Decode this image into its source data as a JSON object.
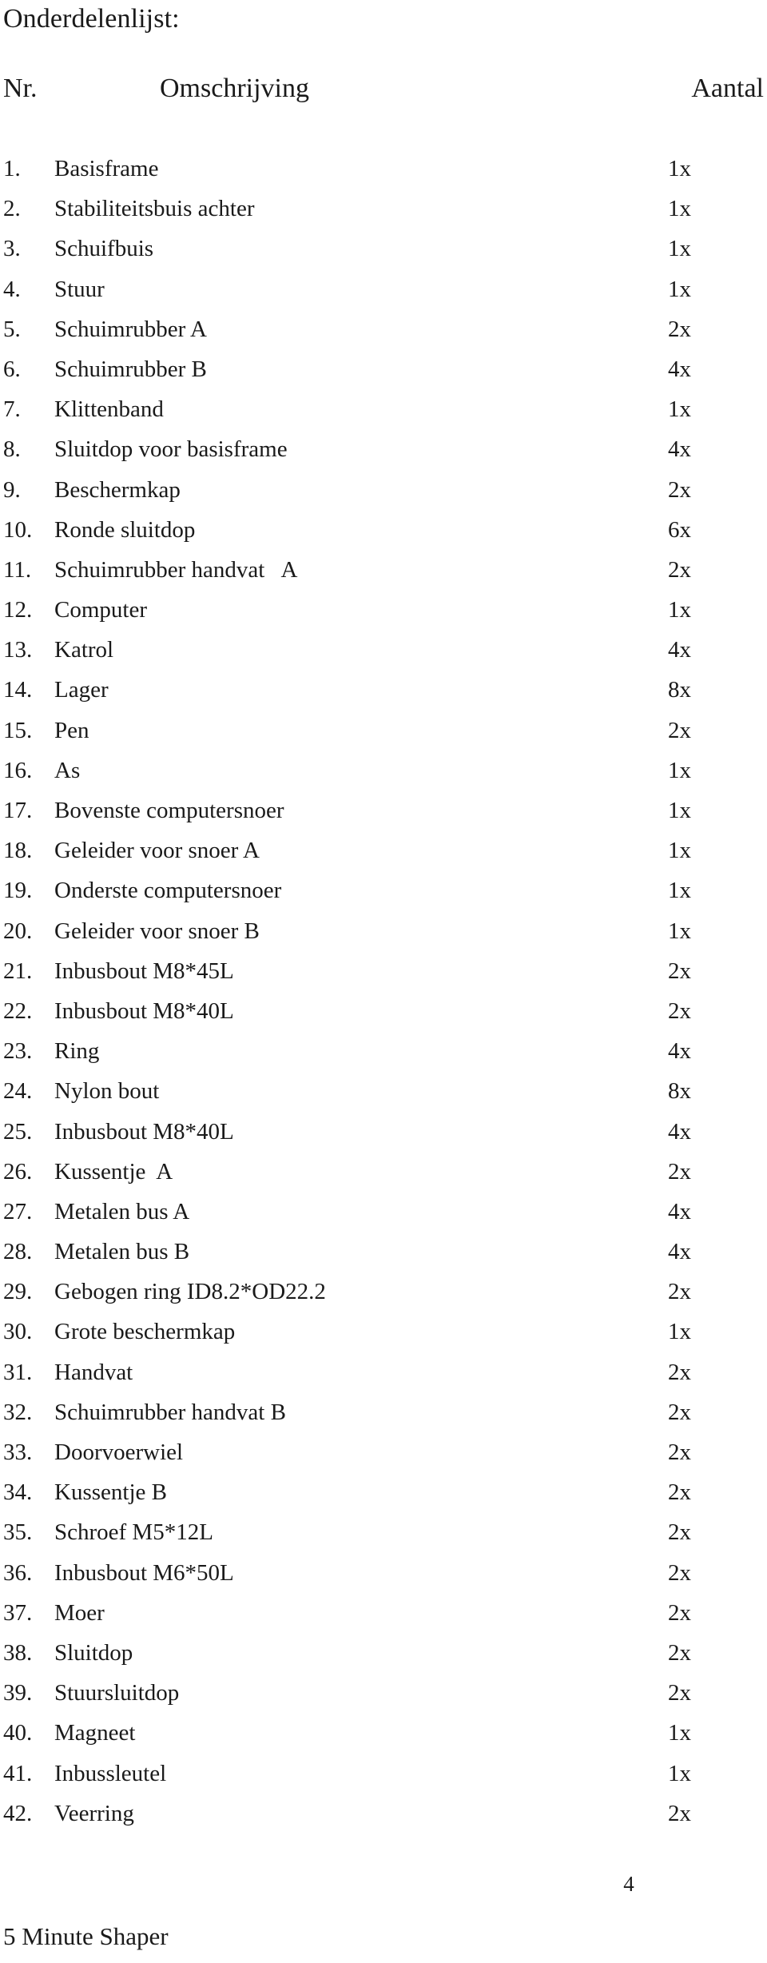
{
  "document": {
    "title": "Onderdelenlijst:",
    "page_number": "4",
    "footer_brand": "5 Minute Shaper"
  },
  "table": {
    "columns": {
      "nr": "Nr.",
      "description": "Omschrijving",
      "quantity": "Aantal"
    },
    "rows": [
      {
        "nr": "1.",
        "description": "Basisframe",
        "qty": "1x"
      },
      {
        "nr": "2.",
        "description": "Stabiliteitsbuis achter",
        "qty": "1x"
      },
      {
        "nr": "3.",
        "description": "Schuifbuis",
        "qty": "1x"
      },
      {
        "nr": "4.",
        "description": "Stuur",
        "qty": "1x"
      },
      {
        "nr": "5.",
        "description": "Schuimrubber A",
        "qty": "2x"
      },
      {
        "nr": "6.",
        "description": "Schuimrubber B",
        "qty": "4x"
      },
      {
        "nr": "7.",
        "description": "Klittenband",
        "qty": "1x"
      },
      {
        "nr": "8.",
        "description": "Sluitdop voor basisframe",
        "qty": "4x"
      },
      {
        "nr": "9.",
        "description": "Beschermkap",
        "qty": "2x"
      },
      {
        "nr": "10.",
        "description": "Ronde sluitdop",
        "qty": "6x"
      },
      {
        "nr": "11.",
        "description": "Schuimrubber handvat   A",
        "qty": "2x"
      },
      {
        "nr": "12.",
        "description": "Computer",
        "qty": "1x"
      },
      {
        "nr": "13.",
        "description": "Katrol",
        "qty": "4x"
      },
      {
        "nr": "14.",
        "description": "Lager",
        "qty": "8x"
      },
      {
        "nr": "15.",
        "description": "Pen",
        "qty": "2x"
      },
      {
        "nr": "16.",
        "description": "As",
        "qty": "1x"
      },
      {
        "nr": "17.",
        "description": "Bovenste computersnoer",
        "qty": "1x"
      },
      {
        "nr": "18.",
        "description": "Geleider voor snoer A",
        "qty": "1x"
      },
      {
        "nr": "19.",
        "description": "Onderste computersnoer",
        "qty": "1x"
      },
      {
        "nr": "20.",
        "description": "Geleider voor snoer B",
        "qty": "1x"
      },
      {
        "nr": "21.",
        "description": "Inbusbout M8*45L",
        "qty": "2x"
      },
      {
        "nr": "22.",
        "description": "Inbusbout M8*40L",
        "qty": "2x"
      },
      {
        "nr": "23.",
        "description": "Ring",
        "qty": "4x"
      },
      {
        "nr": "24.",
        "description": "Nylon bout",
        "qty": "8x"
      },
      {
        "nr": "25.",
        "description": "Inbusbout M8*40L",
        "qty": "4x"
      },
      {
        "nr": "26.",
        "description": "Kussentje  A",
        "qty": "2x"
      },
      {
        "nr": "27.",
        "description": "Metalen bus A",
        "qty": "4x"
      },
      {
        "nr": "28.",
        "description": "Metalen bus B",
        "qty": "4x"
      },
      {
        "nr": "29.",
        "description": "Gebogen ring ID8.2*OD22.2",
        "qty": "2x"
      },
      {
        "nr": "30.",
        "description": "Grote beschermkap",
        "qty": "1x"
      },
      {
        "nr": "31.",
        "description": "Handvat",
        "qty": "2x"
      },
      {
        "nr": "32.",
        "description": "Schuimrubber handvat B",
        "qty": "2x"
      },
      {
        "nr": "33.",
        "description": "Doorvoerwiel",
        "qty": "2x"
      },
      {
        "nr": "34.",
        "description": "Kussentje B",
        "qty": "2x"
      },
      {
        "nr": "35.",
        "description": "Schroef M5*12L",
        "qty": "2x"
      },
      {
        "nr": "36.",
        "description": "Inbusbout M6*50L",
        "qty": "2x"
      },
      {
        "nr": "37.",
        "description": "Moer",
        "qty": "2x"
      },
      {
        "nr": "38.",
        "description": "Sluitdop",
        "qty": "2x"
      },
      {
        "nr": "39.",
        "description": "Stuursluitdop",
        "qty": "2x"
      },
      {
        "nr": "40.",
        "description": "Magneet",
        "qty": "1x"
      },
      {
        "nr": "41.",
        "description": "Inbussleutel",
        "qty": "1x"
      },
      {
        "nr": "42.",
        "description": "Veerring",
        "qty": "2x"
      }
    ]
  },
  "colors": {
    "text": "#1a1a1a",
    "background": "#ffffff"
  }
}
